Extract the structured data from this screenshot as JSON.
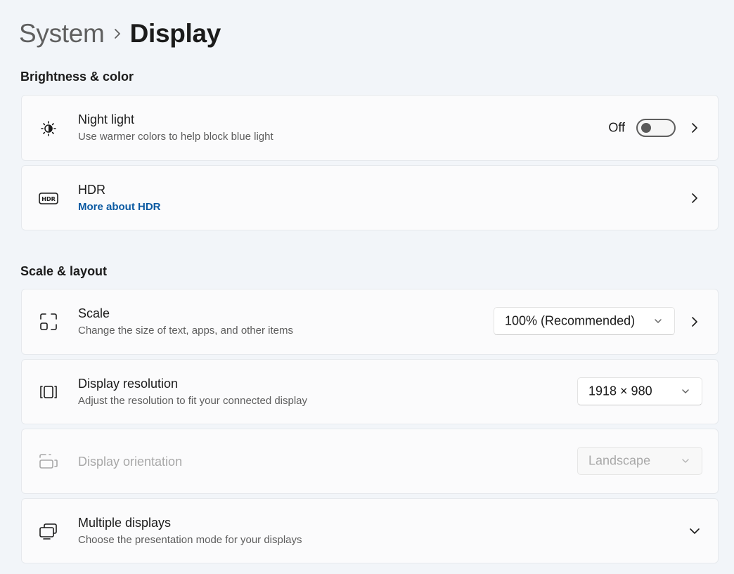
{
  "breadcrumb": {
    "parent": "System",
    "current": "Display"
  },
  "sections": {
    "brightness": "Brightness & color",
    "scale_layout": "Scale & layout"
  },
  "night_light": {
    "icon": "brightness-icon",
    "title": "Night light",
    "subtitle": "Use warmer colors to help block blue light",
    "toggle_state": "Off"
  },
  "hdr": {
    "icon": "hdr-icon",
    "title": "HDR",
    "link": "More about HDR"
  },
  "scale": {
    "icon": "scale-icon",
    "title": "Scale",
    "subtitle": "Change the size of text, apps, and other items",
    "value": "100% (Recommended)"
  },
  "resolution": {
    "icon": "resolution-icon",
    "title": "Display resolution",
    "subtitle": "Adjust the resolution to fit your connected display",
    "value": "1918 × 980"
  },
  "orientation": {
    "icon": "orientation-icon",
    "title": "Display orientation",
    "value": "Landscape"
  },
  "multiple_displays": {
    "icon": "multiple-displays-icon",
    "title": "Multiple displays",
    "subtitle": "Choose the presentation mode for your displays"
  },
  "colors": {
    "background": "#f2f5f9",
    "card": "#fbfbfc",
    "link": "#0b5aa2",
    "disabled": "#a8a8a8"
  }
}
